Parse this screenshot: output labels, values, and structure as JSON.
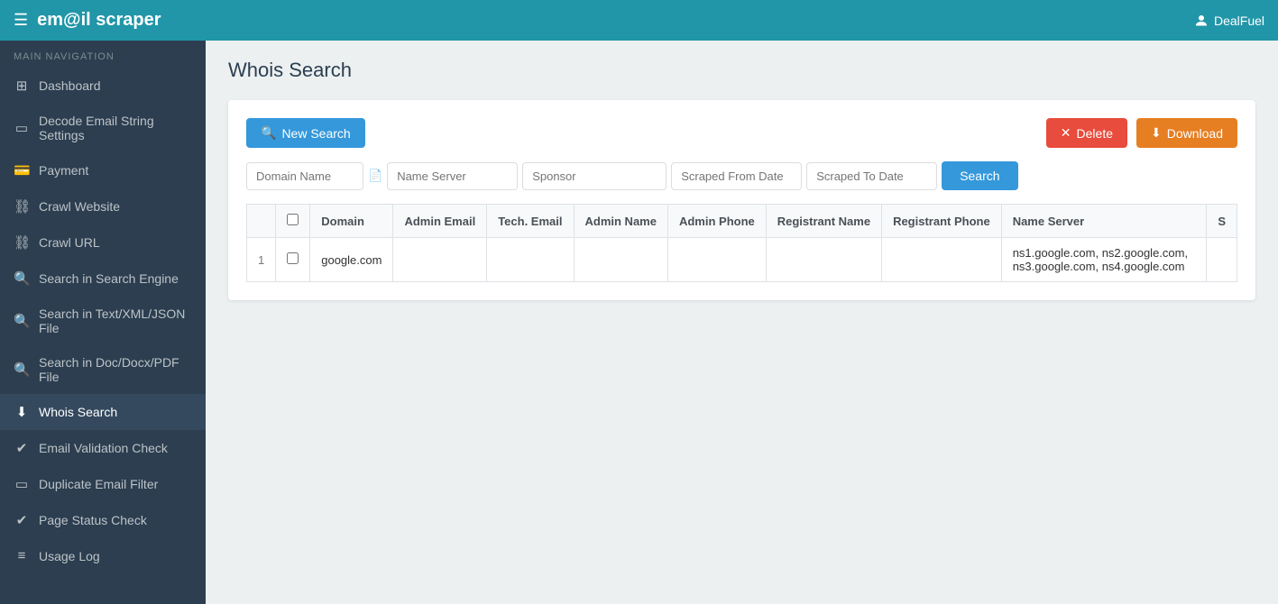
{
  "topbar": {
    "logo_prefix": "em",
    "logo_at": "@",
    "logo_suffix": "il scraper",
    "menu_icon": "☰",
    "user_label": "DealFuel"
  },
  "sidebar": {
    "nav_label": "MAIN NAVIGATION",
    "items": [
      {
        "id": "dashboard",
        "label": "Dashboard",
        "icon": "⊞"
      },
      {
        "id": "decode-email",
        "label": "Decode Email String Settings",
        "icon": "▭"
      },
      {
        "id": "payment",
        "label": "Payment",
        "icon": "💳"
      },
      {
        "id": "crawl-website",
        "label": "Crawl Website",
        "icon": "🔗"
      },
      {
        "id": "crawl-url",
        "label": "Crawl URL",
        "icon": "🔗"
      },
      {
        "id": "search-engine",
        "label": "Search in Search Engine",
        "icon": "🔍"
      },
      {
        "id": "search-text",
        "label": "Search in Text/XML/JSON File",
        "icon": "🔍"
      },
      {
        "id": "search-doc",
        "label": "Search in Doc/Docx/PDF File",
        "icon": "🔍"
      },
      {
        "id": "whois-search",
        "label": "Whois Search",
        "icon": "⬇",
        "active": true
      },
      {
        "id": "email-validation",
        "label": "Email Validation Check",
        "icon": "✔"
      },
      {
        "id": "duplicate-email",
        "label": "Duplicate Email Filter",
        "icon": "▭"
      },
      {
        "id": "page-status",
        "label": "Page Status Check",
        "icon": "✔"
      },
      {
        "id": "usage-log",
        "label": "Usage Log",
        "icon": "≡"
      }
    ]
  },
  "page": {
    "title": "Whois Search"
  },
  "toolbar": {
    "new_search_label": "New Search",
    "delete_label": "Delete",
    "download_label": "Download"
  },
  "filters": {
    "domain_name_placeholder": "Domain Name",
    "name_server_placeholder": "Name Server",
    "sponsor_placeholder": "Sponsor",
    "scraped_from_date_placeholder": "Scraped From Date",
    "scraped_to_date_placeholder": "Scraped To Date",
    "search_label": "Search"
  },
  "table": {
    "columns": [
      "Domain",
      "Admin Email",
      "Tech. Email",
      "Admin Name",
      "Admin Phone",
      "Registrant Name",
      "Registrant Phone",
      "Name Server",
      "S"
    ],
    "rows": [
      {
        "num": "1",
        "domain": "google.com",
        "admin_email": "",
        "tech_email": "",
        "admin_name": "",
        "admin_phone": "",
        "registrant_name": "",
        "registrant_phone": "",
        "name_server": "ns1.google.com, ns2.google.com, ns3.google.com, ns4.google.com",
        "s": ""
      }
    ]
  }
}
